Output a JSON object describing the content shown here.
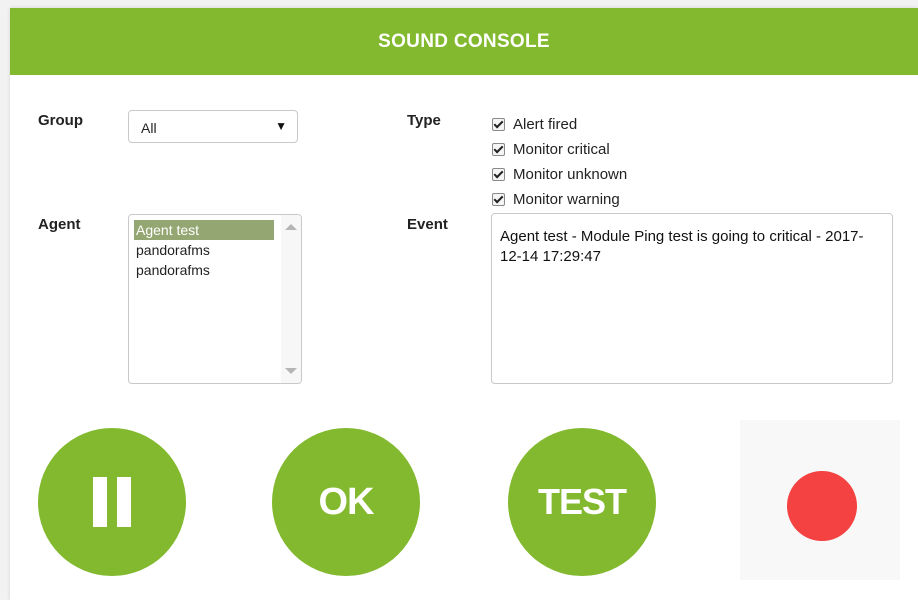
{
  "header": {
    "title": "SOUND CONSOLE"
  },
  "group": {
    "label": "Group",
    "selected": "All"
  },
  "type": {
    "label": "Type",
    "options": [
      {
        "label": "Alert fired",
        "checked": true
      },
      {
        "label": "Monitor critical",
        "checked": true
      },
      {
        "label": "Monitor unknown",
        "checked": true
      },
      {
        "label": "Monitor warning",
        "checked": true
      }
    ]
  },
  "agent": {
    "label": "Agent",
    "items": [
      "Agent test",
      "pandorafms",
      "pandorafms"
    ],
    "selected_index": 0
  },
  "event": {
    "label": "Event",
    "text": "Agent test - Module Ping test is going to critical - 2017-12-14 17:29:47"
  },
  "buttons": {
    "pause": "pause-icon",
    "ok_label": "OK",
    "test_label": "TEST",
    "record": "record-icon"
  },
  "colors": {
    "accent": "#82b92e",
    "record": "#f44141",
    "selection": "#94a772"
  }
}
